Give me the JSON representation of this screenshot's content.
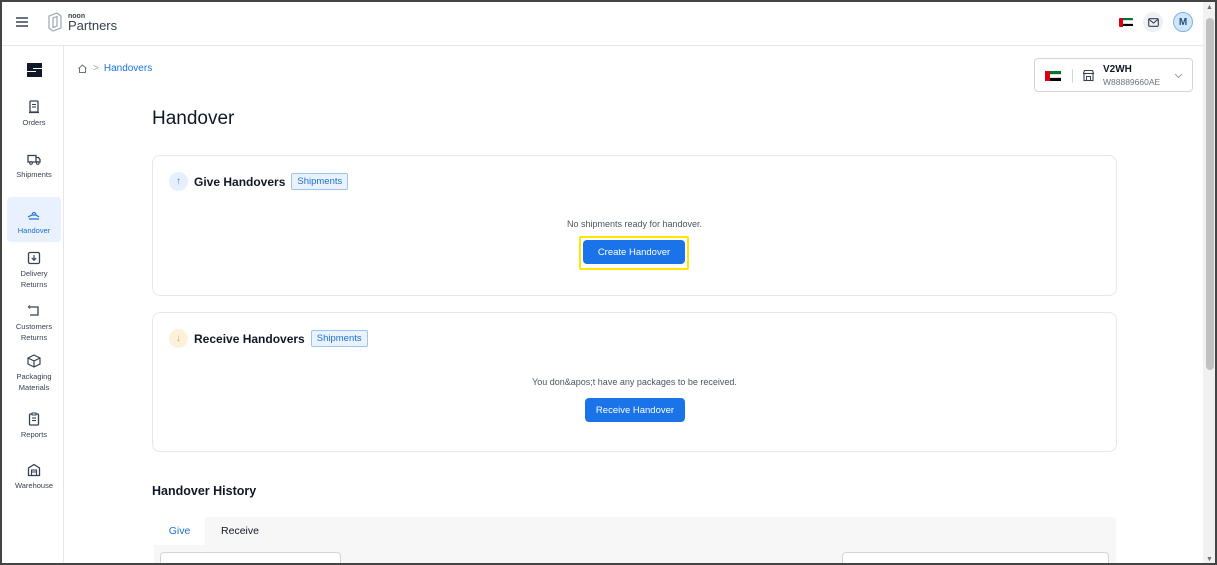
{
  "brand": {
    "small": "noon",
    "big": "Partners"
  },
  "topbar": {
    "avatar_initial": "M"
  },
  "sidebar": {
    "items": [
      {
        "label": "Orders"
      },
      {
        "label": "Shipments"
      },
      {
        "label": "Handover"
      },
      {
        "label": "Delivery Returns"
      },
      {
        "label": "Customers Returns"
      },
      {
        "label": "Packaging Materials"
      },
      {
        "label": "Reports"
      },
      {
        "label": "Warehouse"
      }
    ],
    "active": "Handover"
  },
  "breadcrumb": {
    "separator": ">",
    "current": "Handovers"
  },
  "store": {
    "name": "V2WH",
    "code": "W88889660AE"
  },
  "page": {
    "title": "Handover"
  },
  "give": {
    "title": "Give Handovers",
    "tag": "Shipments",
    "message": "No shipments ready for handover.",
    "button": "Create Handover"
  },
  "receive": {
    "title": "Receive Handovers",
    "tag": "Shipments",
    "message": "You don&apos;t have any packages to be received.",
    "button": "Receive Handover"
  },
  "history": {
    "title": "Handover History",
    "tabs": [
      "Give",
      "Receive"
    ],
    "active_tab": "Give"
  },
  "colors": {
    "accent": "#1a73e8",
    "highlight": "#ffe600",
    "active_nav_bg": "#e8f1fd"
  }
}
